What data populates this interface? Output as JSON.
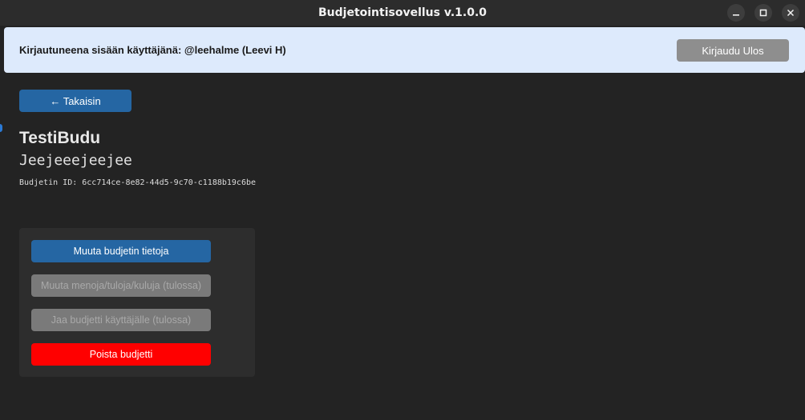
{
  "window": {
    "title": "Budjetointisovellus v.1.0.0",
    "controls": [
      "minimize-icon",
      "maximize-icon",
      "close-icon"
    ]
  },
  "header": {
    "logged_in_text": "Kirjautuneena sisään käyttäjänä: @leehalme (Leevi H)",
    "logout_label": "Kirjaudu Ulos"
  },
  "nav": {
    "back_label": "← Takaisin"
  },
  "budget": {
    "name": "TestiBudu",
    "description": "Jeejeeejeejee",
    "id_text": "Budjetin ID: 6cc714ce-8e82-44d5-9c70-c1188b19c6be"
  },
  "actions": {
    "edit_info": "Muuta budjetin tietoja",
    "edit_entries": "Muuta menoja/tuloja/kuluja (tulossa)",
    "share": "Jaa budjetti käyttäjälle (tulossa)",
    "delete": "Poista budjetti"
  },
  "colors": {
    "primary": "#2566a3",
    "danger": "#ff0000",
    "disabled": "#7a7a7a",
    "banner": "#ddeafc",
    "background": "#232323"
  }
}
